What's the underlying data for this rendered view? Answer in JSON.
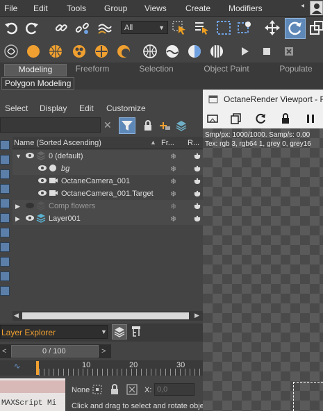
{
  "menubar": {
    "items": [
      "File",
      "Edit",
      "Tools",
      "Group",
      "Views",
      "Create",
      "Modifiers"
    ]
  },
  "toolbar": {
    "selection_filter": "All"
  },
  "ribbon": {
    "tabs": [
      "Modeling",
      "Freeform",
      "Selection",
      "Object Paint",
      "Populate"
    ],
    "active_tab": "Modeling",
    "sub_label": "Polygon Modeling"
  },
  "scene_explorer": {
    "menu": [
      "Select",
      "Display",
      "Edit",
      "Customize"
    ],
    "columns": {
      "name": "Name (Sorted Ascending)",
      "frozen": "Fr...",
      "render": "R..."
    },
    "rows": [
      {
        "label": "0 (default)"
      },
      {
        "label": "bg"
      },
      {
        "label": "OctaneCamera_001"
      },
      {
        "label": "OctaneCamera_001.Target"
      },
      {
        "label": "Comp flowers"
      },
      {
        "label": "Layer001"
      }
    ],
    "explorer_name": "Layer Explorer"
  },
  "timeline": {
    "frame_display": "0 / 100",
    "ruler_labels": [
      "10",
      "20",
      "30"
    ]
  },
  "status": {
    "none_label": "None",
    "x_label": "X:",
    "x_value": "0,0",
    "prompt": "Click and drag to select and rotate obje",
    "maxscript_label": "MAXScript Mi"
  },
  "viewport": {
    "title": "OctaneRender Viewport - R",
    "stats_line1": "Smp/px: 1000/1000.   Samp/s: 0.00",
    "stats_line2": "Tex: rgb 3, rgb64 1, grey 0, grey16"
  }
}
